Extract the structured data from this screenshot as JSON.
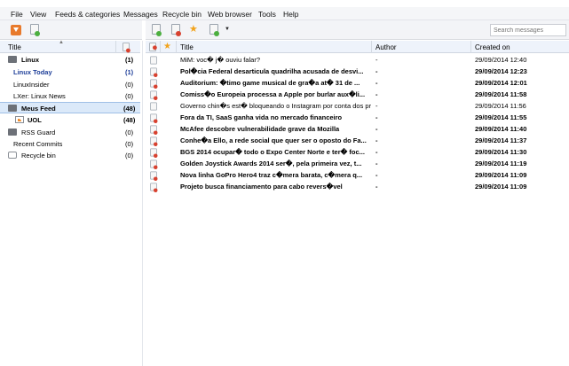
{
  "menu": {
    "file": "File",
    "view": "View",
    "feeds": "Feeds & categories",
    "messages": "Messages",
    "recycle": "Recycle bin",
    "web": "Web browser",
    "tools": "Tools",
    "help": "Help"
  },
  "search": {
    "placeholder": "Search messages"
  },
  "feeds_panel": {
    "header": {
      "title": "Title"
    },
    "items": [
      {
        "title": "Linux",
        "count": "(1)",
        "icon": "folder-icon"
      },
      {
        "title": "Linux Today",
        "count": "(1)",
        "icon": "none"
      },
      {
        "title": "LinuxInsider",
        "count": "(0)",
        "icon": "none"
      },
      {
        "title": "LXer: Linux News",
        "count": "(0)",
        "icon": "none"
      },
      {
        "title": "Meus Feed",
        "count": "(48)",
        "icon": "folder-icon"
      },
      {
        "title": "UOL",
        "count": "(48)",
        "icon": "rss-icon"
      },
      {
        "title": "RSS Guard",
        "count": "(0)",
        "icon": "folder-icon"
      },
      {
        "title": "Recent Commits",
        "count": "(0)",
        "icon": "none"
      },
      {
        "title": "Recycle bin",
        "count": "(0)",
        "icon": "recycle-bin-icon"
      }
    ]
  },
  "messages_panel": {
    "columns": {
      "title": "Title",
      "author": "Author",
      "created": "Created on"
    },
    "rows": [
      {
        "title": "MiM: voc� j� ouviu falar?",
        "author": "-",
        "date": "29/09/2014 12:40",
        "unread": false
      },
      {
        "title": "Pol�cia Federal desarticula quadrilha acusada de desvi...",
        "author": "-",
        "date": "29/09/2014 12:23",
        "unread": true
      },
      {
        "title": "Auditorium: �timo game musical de gra�a at� 31 de ...",
        "author": "-",
        "date": "29/09/2014 12:01",
        "unread": true
      },
      {
        "title": "Comiss�o Europeia processa a Apple por burlar aux�li...",
        "author": "-",
        "date": "29/09/2014 11:58",
        "unread": true
      },
      {
        "title": "Governo chin�s est� bloqueando o Instagram por conta dos pr...",
        "author": "-",
        "date": "29/09/2014 11:56",
        "unread": false
      },
      {
        "title": "Fora da TI, SaaS ganha vida no mercado financeiro",
        "author": "-",
        "date": "29/09/2014 11:55",
        "unread": true
      },
      {
        "title": "McAfee descobre vulnerabilidade grave da Mozilla",
        "author": "-",
        "date": "29/09/2014 11:40",
        "unread": true
      },
      {
        "title": "Conhe�a Ello, a rede social que quer ser o oposto do Fa...",
        "author": "-",
        "date": "29/09/2014 11:37",
        "unread": true
      },
      {
        "title": "BGS 2014 ocupar� todo o Expo Center Norte e ter� foc...",
        "author": "-",
        "date": "29/09/2014 11:30",
        "unread": true
      },
      {
        "title": "Golden Joystick Awards 2014 ser�, pela primeira vez, t...",
        "author": "-",
        "date": "29/09/2014 11:19",
        "unread": true
      },
      {
        "title": "Nova linha GoPro Hero4 traz c�mera barata, c�mera q...",
        "author": "-",
        "date": "29/09/2014 11:09",
        "unread": true
      },
      {
        "title": "Projeto busca financiamento para cabo revers�vel",
        "author": "-",
        "date": "29/09/2014 11:09",
        "unread": true
      }
    ]
  },
  "colors": {
    "selection": "#dbe9f9",
    "header_bg": "#eef3fb",
    "unread_feed": "#20409a"
  }
}
